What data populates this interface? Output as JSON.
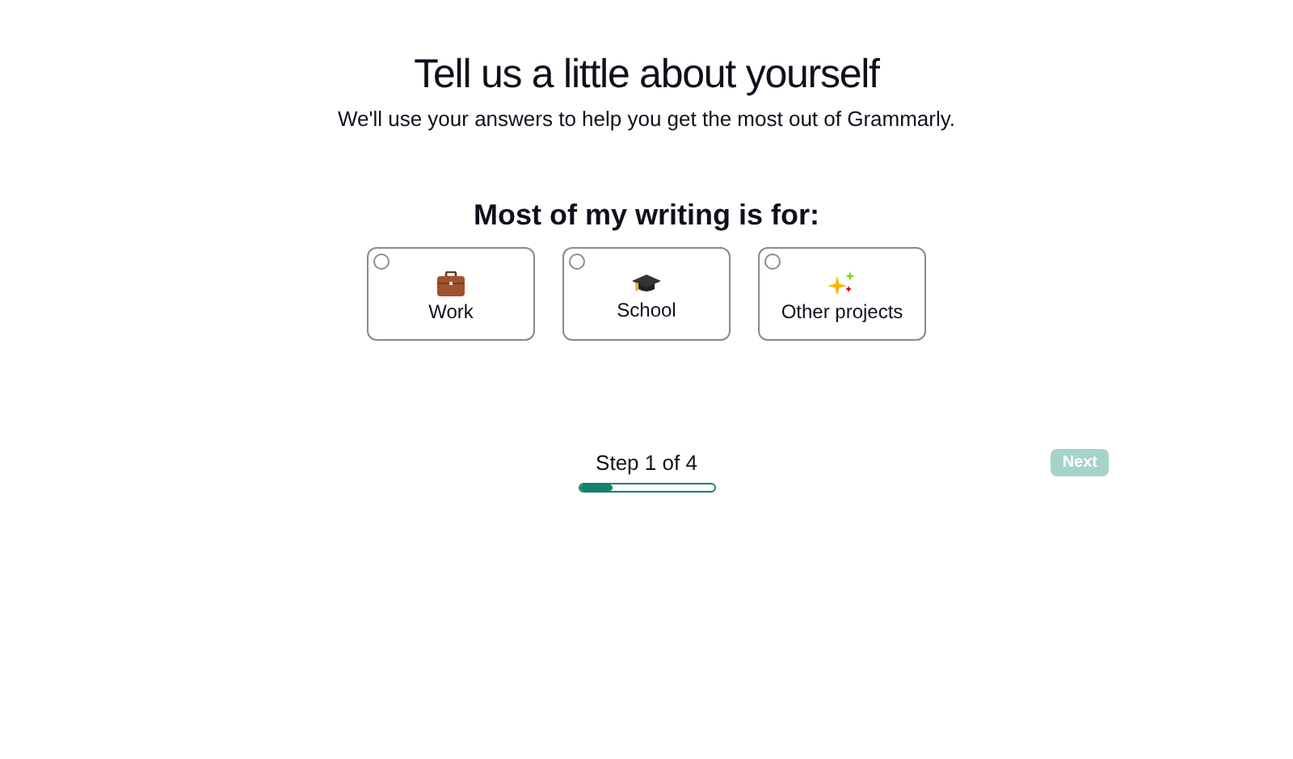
{
  "header": {
    "title": "Tell us a little about yourself",
    "subtitle": "We'll use your answers to help you get the most out of Grammarly."
  },
  "question": "Most of my writing is for:",
  "options": [
    {
      "kind": "work",
      "label": "Work",
      "selected": false
    },
    {
      "kind": "school",
      "label": "School",
      "selected": false
    },
    {
      "kind": "other",
      "label": "Other projects",
      "selected": false
    }
  ],
  "progress": {
    "label": "Step 1 of 4",
    "level": 0.25
  },
  "next_button": {
    "label": "Next",
    "disabled": true
  }
}
